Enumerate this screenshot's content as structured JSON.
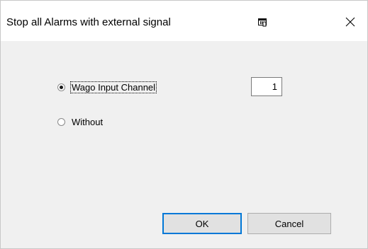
{
  "window": {
    "title": "Stop all Alarms with external signal",
    "close_icon": "close-icon",
    "system_icon": "window-menu-icon"
  },
  "options": {
    "wago_label": "Wago Input Channel",
    "wago_selected": true,
    "without_label": "Without",
    "without_selected": false
  },
  "channel_input": {
    "value": "1"
  },
  "buttons": {
    "ok_label": "OK",
    "cancel_label": "Cancel"
  }
}
